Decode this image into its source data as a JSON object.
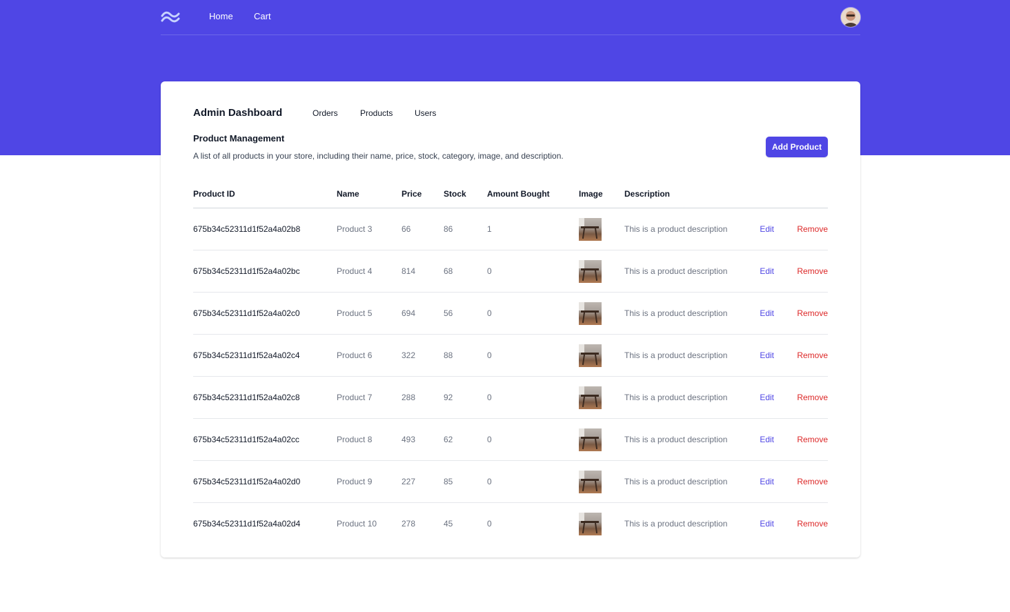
{
  "nav": {
    "logo_icon": "tailwind-waves-icon",
    "links": [
      {
        "label": "Home"
      },
      {
        "label": "Cart"
      }
    ],
    "avatar_icon": "user-avatar"
  },
  "dashboard": {
    "title": "Admin Dashboard",
    "tabs": [
      {
        "label": "Orders"
      },
      {
        "label": "Products"
      },
      {
        "label": "Users"
      }
    ]
  },
  "section": {
    "title": "Product Management",
    "description": "A list of all products in your store, including their name, price, stock, category, image, and description.",
    "add_button_label": "Add Product"
  },
  "table": {
    "columns": [
      "Product ID",
      "Name",
      "Price",
      "Stock",
      "Amount Bought",
      "Image",
      "Description"
    ],
    "edit_label": "Edit",
    "remove_label": "Remove",
    "rows": [
      {
        "id": "675b34c52311d1f52a4a02b8",
        "name": "Product 3",
        "price": "66",
        "stock": "86",
        "bought": "1",
        "description": "This is a product description"
      },
      {
        "id": "675b34c52311d1f52a4a02bc",
        "name": "Product 4",
        "price": "814",
        "stock": "68",
        "bought": "0",
        "description": "This is a product description"
      },
      {
        "id": "675b34c52311d1f52a4a02c0",
        "name": "Product 5",
        "price": "694",
        "stock": "56",
        "bought": "0",
        "description": "This is a product description"
      },
      {
        "id": "675b34c52311d1f52a4a02c4",
        "name": "Product 6",
        "price": "322",
        "stock": "88",
        "bought": "0",
        "description": "This is a product description"
      },
      {
        "id": "675b34c52311d1f52a4a02c8",
        "name": "Product 7",
        "price": "288",
        "stock": "92",
        "bought": "0",
        "description": "This is a product description"
      },
      {
        "id": "675b34c52311d1f52a4a02cc",
        "name": "Product 8",
        "price": "493",
        "stock": "62",
        "bought": "0",
        "description": "This is a product description"
      },
      {
        "id": "675b34c52311d1f52a4a02d0",
        "name": "Product 9",
        "price": "227",
        "stock": "85",
        "bought": "0",
        "description": "This is a product description"
      },
      {
        "id": "675b34c52311d1f52a4a02d4",
        "name": "Product 10",
        "price": "278",
        "stock": "45",
        "bought": "0",
        "description": "This is a product description"
      }
    ]
  },
  "colors": {
    "brand": "#4f46e5",
    "danger": "#dc2626"
  }
}
